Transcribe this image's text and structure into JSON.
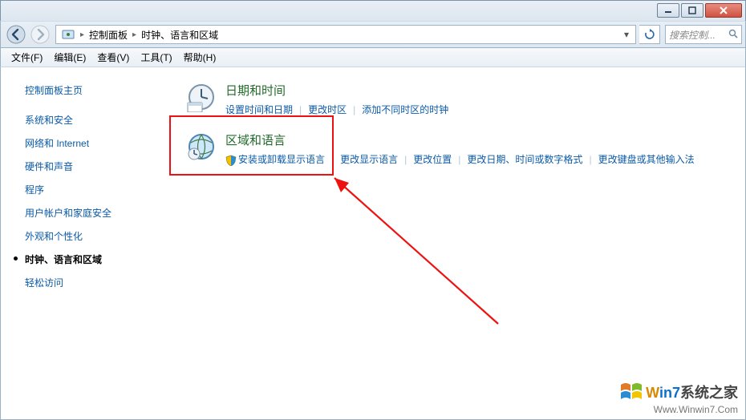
{
  "breadcrumb": {
    "root": "控制面板",
    "current": "时钟、语言和区域"
  },
  "search": {
    "placeholder": "搜索控制..."
  },
  "menu": {
    "file": "文件(F)",
    "edit": "编辑(E)",
    "view": "查看(V)",
    "tools": "工具(T)",
    "help": "帮助(H)"
  },
  "sidebar": {
    "home": "控制面板主页",
    "items": [
      "系统和安全",
      "网络和 Internet",
      "硬件和声音",
      "程序",
      "用户帐户和家庭安全",
      "外观和个性化",
      "时钟、语言和区域",
      "轻松访问"
    ],
    "current_index": 6
  },
  "categories": [
    {
      "title": "日期和时间",
      "icon": "clock",
      "links": [
        "设置时间和日期",
        "更改时区",
        "添加不同时区的时钟"
      ]
    },
    {
      "title": "区域和语言",
      "icon": "globe",
      "links": [
        "安装或卸载显示语言",
        "更改显示语言",
        "更改位置",
        "更改日期、时间或数字格式",
        "更改键盘或其他输入法"
      ],
      "shield_on": [
        0
      ]
    }
  ],
  "watermark": {
    "line1a": "W",
    "line1b": "in7",
    "line1c": "系统之家",
    "line2": "Www.Winwin7.Com"
  }
}
